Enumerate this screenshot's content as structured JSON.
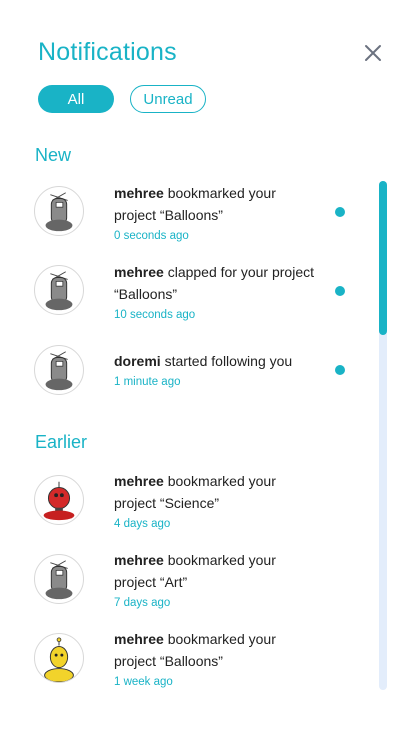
{
  "header": {
    "title": "Notifications"
  },
  "filters": {
    "all_label": "All",
    "unread_label": "Unread",
    "selected": "All"
  },
  "sections": {
    "new": {
      "label": "New",
      "items": [
        {
          "user": "mehree",
          "action": " bookmarked your project “Balloons”",
          "time": "0 seconds ago",
          "unread": true,
          "avatar": "gray-robot-avatar"
        },
        {
          "user": "mehree",
          "action": " clapped for your project “Balloons”",
          "time": "10 seconds ago",
          "unread": true,
          "avatar": "gray-robot-avatar"
        },
        {
          "user": "doremi",
          "action": " started following you",
          "time": "1 minute ago",
          "unread": true,
          "avatar": "gray-robot-avatar"
        }
      ]
    },
    "earlier": {
      "label": "Earlier",
      "items": [
        {
          "user": "mehree",
          "action": " bookmarked your project “Science”",
          "time": "4 days ago",
          "unread": false,
          "avatar": "red-robot-avatar"
        },
        {
          "user": "mehree",
          "action": " bookmarked your project “Art”",
          "time": "7 days ago",
          "unread": false,
          "avatar": "gray-robot-avatar"
        },
        {
          "user": "mehree",
          "action": " bookmarked your project “Balloons”",
          "time": "1 week ago",
          "unread": false,
          "avatar": "yellow-robot-avatar"
        }
      ]
    }
  },
  "colors": {
    "accent": "#19b3c6",
    "scroll_track": "#e3edfb"
  }
}
